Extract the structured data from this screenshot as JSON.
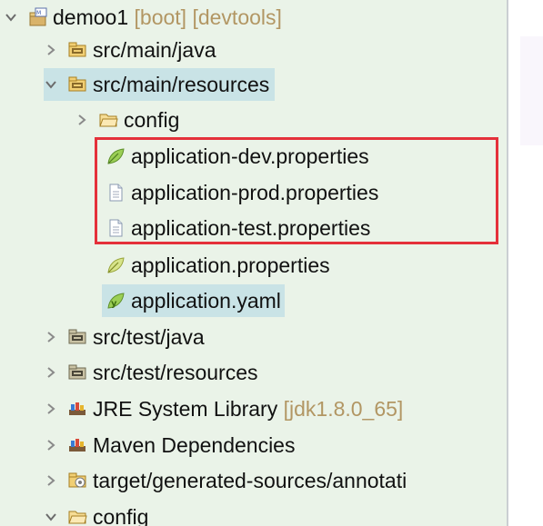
{
  "tree": {
    "items": [
      {
        "label": "demoo1",
        "decor": " [boot] [devtools]",
        "icon": "project-icon",
        "chevron": "expanded"
      },
      {
        "label": "src/main/java",
        "icon": "source-folder-icon",
        "chevron": "collapsed"
      },
      {
        "label": "src/main/resources",
        "icon": "source-folder-icon",
        "chevron": "expanded",
        "selected": true
      },
      {
        "label": "config",
        "icon": "folder-icon",
        "chevron": "collapsed"
      },
      {
        "label": "application-dev.properties",
        "icon": "spring-leaf-icon"
      },
      {
        "label": "application-prod.properties",
        "icon": "file-icon"
      },
      {
        "label": "application-test.properties",
        "icon": "file-icon"
      },
      {
        "label": "application.properties",
        "icon": "spring-leaf-icon"
      },
      {
        "label": "application.yaml",
        "icon": "spring-yaml-icon",
        "selected": true
      },
      {
        "label": "src/test/java",
        "icon": "test-source-folder-icon",
        "chevron": "collapsed"
      },
      {
        "label": "src/test/resources",
        "icon": "test-source-folder-icon",
        "chevron": "collapsed"
      },
      {
        "label": "JRE System Library",
        "decor": " [jdk1.8.0_65]",
        "icon": "library-icon",
        "chevron": "collapsed"
      },
      {
        "label": "Maven Dependencies",
        "icon": "library-icon",
        "chevron": "collapsed"
      },
      {
        "label": "target/generated-sources/annotati",
        "icon": "generated-folder-icon",
        "chevron": "collapsed"
      },
      {
        "label": "config",
        "icon": "folder-icon",
        "chevron": "expanded"
      }
    ]
  },
  "colors": {
    "background": "#eaf3e8",
    "selection": "#c9e3e6",
    "highlight": "#e4303a",
    "decorator": "#b29663"
  }
}
